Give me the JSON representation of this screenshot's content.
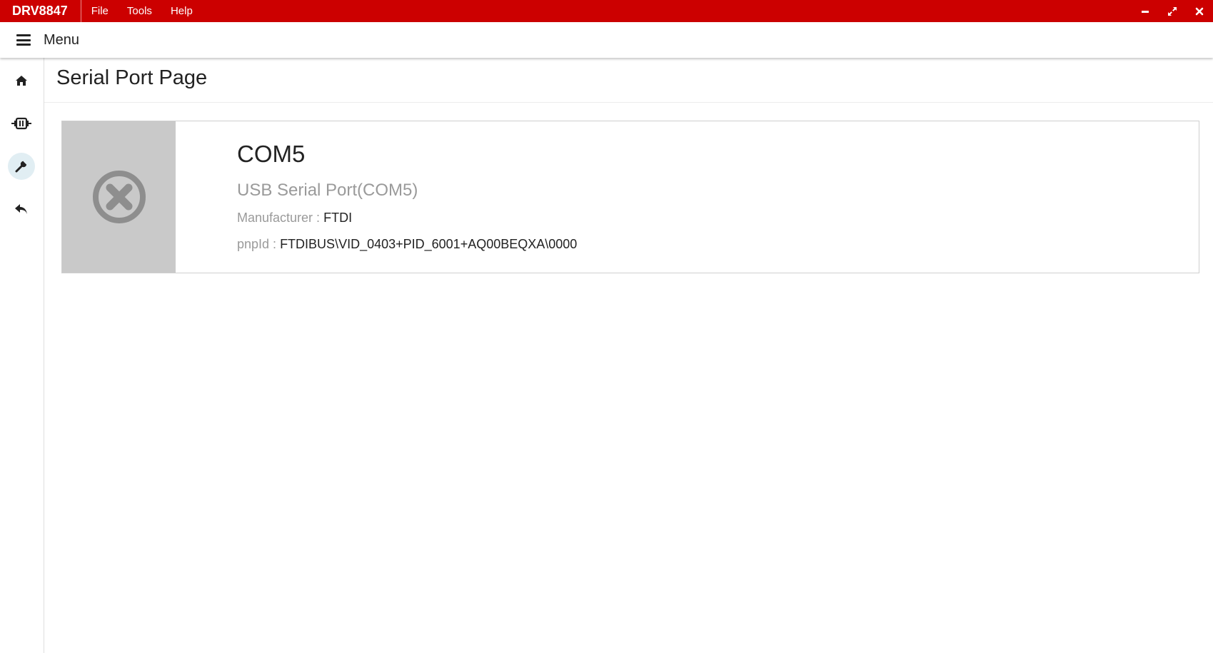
{
  "titlebar": {
    "app_title": "DRV8847",
    "menus": [
      "File",
      "Tools",
      "Help"
    ]
  },
  "menubar": {
    "label": "Menu"
  },
  "page": {
    "title": "Serial Port Page"
  },
  "port": {
    "name": "COM5",
    "description": "USB Serial Port(COM5)",
    "manufacturer_label": "Manufacturer :",
    "manufacturer": "FTDI",
    "pnpid_label": "pnpId :",
    "pnpid": "FTDIBUS\\VID_0403+PID_6001+AQ00BEQXA\\0000"
  },
  "colors": {
    "accent": "#cc0000",
    "active_nav": "#e1eef3",
    "thumb": "#c9c9c9",
    "muted": "#9a9a9a"
  },
  "icons": [
    "home-icon",
    "motor-icon",
    "wrench-icon",
    "back-icon",
    "close-circle-icon",
    "minimize-icon",
    "maximize-icon",
    "close-icon"
  ]
}
